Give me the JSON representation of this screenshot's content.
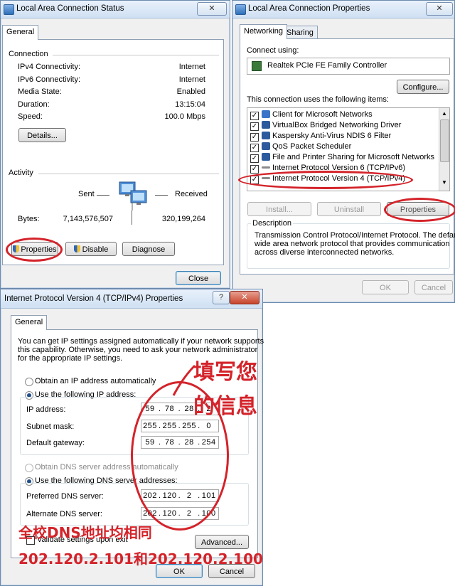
{
  "status_window": {
    "title": "Local Area Connection Status",
    "tab_general": "General",
    "connection_heading": "Connection",
    "rows": [
      {
        "label": "IPv4 Connectivity:",
        "value": "Internet"
      },
      {
        "label": "IPv6 Connectivity:",
        "value": "Internet"
      },
      {
        "label": "Media State:",
        "value": "Enabled"
      },
      {
        "label": "Duration:",
        "value": "13:15:04"
      },
      {
        "label": "Speed:",
        "value": "100.0 Mbps"
      }
    ],
    "details_button": "Details...",
    "activity_heading": "Activity",
    "sent_label": "Sent",
    "received_label": "Received",
    "bytes_label": "Bytes:",
    "bytes_sent": "7,143,576,507",
    "bytes_received": "320,199,264",
    "properties_button": "Properties",
    "disable_button": "Disable",
    "diagnose_button": "Diagnose",
    "close_button": "Close"
  },
  "properties_window": {
    "title": "Local Area Connection Properties",
    "tab_networking": "Networking",
    "tab_sharing": "Sharing",
    "connect_using_label": "Connect using:",
    "adapter_name": "Realtek PCIe FE Family Controller",
    "configure_button": "Configure...",
    "items_label": "This connection uses the following items:",
    "items": [
      "Client for Microsoft Networks",
      "VirtualBox Bridged Networking Driver",
      "Kaspersky Anti-Virus NDIS 6 Filter",
      "QoS Packet Scheduler",
      "File and Printer Sharing for Microsoft Networks",
      "Internet Protocol Version 6 (TCP/IPv6)",
      "Internet Protocol Version 4 (TCP/IPv4)"
    ],
    "install_button": "Install...",
    "uninstall_button": "Uninstall",
    "properties_button": "Properties",
    "description_heading": "Description",
    "description_text_1": "Transmission Control Protocol/Internet Protocol. The default",
    "description_text_2": "wide area network protocol that provides communication",
    "description_text_3": "across diverse interconnected networks.",
    "ok_button": "OK",
    "cancel_button": "Cancel"
  },
  "ipv4_window": {
    "title": "Internet Protocol Version 4 (TCP/IPv4) Properties",
    "help_button": "?",
    "tab_general": "General",
    "intro_1": "You can get IP settings assigned automatically if your network supports",
    "intro_2": "this capability. Otherwise, you need to ask your network administrator",
    "intro_3": "for the appropriate IP settings.",
    "obtain_ip_auto": "Obtain an IP address automatically",
    "use_following_ip": "Use the following IP address:",
    "ip_address_label": "IP address:",
    "ip_address": [
      "59",
      "78",
      "28",
      "2"
    ],
    "subnet_label": "Subnet mask:",
    "subnet": [
      "255",
      "255",
      "255",
      "0"
    ],
    "gateway_label": "Default gateway:",
    "gateway": [
      "59",
      "78",
      "28",
      "254"
    ],
    "obtain_dns_auto": "Obtain DNS server address automatically",
    "use_following_dns": "Use the following DNS server addresses:",
    "preferred_dns_label": "Preferred DNS server:",
    "preferred_dns": [
      "202",
      "120",
      "2",
      "101"
    ],
    "alternate_dns_label": "Alternate DNS server:",
    "alternate_dns": [
      "202",
      "120",
      "2",
      "100"
    ],
    "validate_label": "Validate settings upon exit",
    "advanced_button": "Advanced...",
    "ok_button": "OK",
    "cancel_button": "Cancel"
  },
  "annotations": {
    "fill_in_line1": "填写您",
    "fill_in_line2": "的信息",
    "dns_note_line1": "全校DNS地址均相同",
    "dns_note_line2": "202.120.2.101和202.120.2.100"
  },
  "colors": {
    "annotation_red": "#d4232a",
    "titlebar": "#cfe0f3"
  }
}
